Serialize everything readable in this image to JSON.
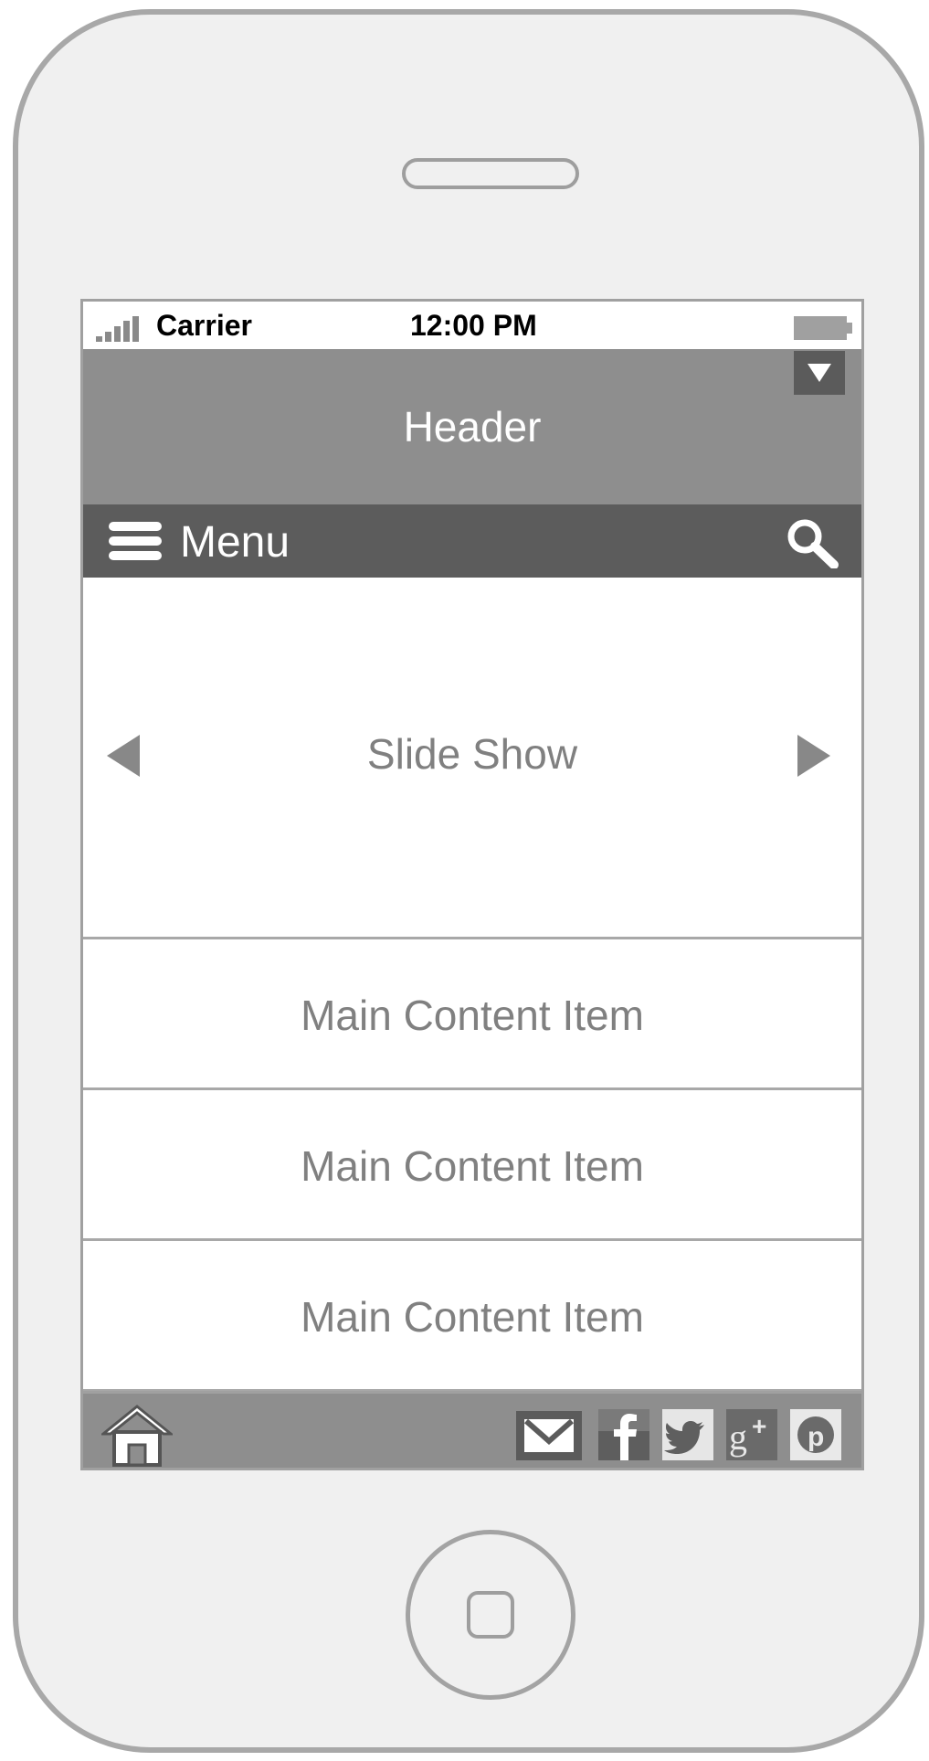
{
  "status_bar": {
    "carrier": "Carrier",
    "time": "12:00 PM"
  },
  "header": {
    "title": "Header"
  },
  "nav": {
    "menu_label": "Menu"
  },
  "slideshow": {
    "label": "Slide Show"
  },
  "main": {
    "items": [
      {
        "label": "Main Content Item"
      },
      {
        "label": "Main Content Item"
      },
      {
        "label": "Main Content Item"
      }
    ]
  },
  "footer": {
    "social_icons": [
      "facebook-icon",
      "twitter-icon",
      "google-plus-icon",
      "pinterest-icon"
    ]
  },
  "colors": {
    "header_bg": "#8e8e8e",
    "menubar_bg": "#5c5c5c",
    "text_gray": "#808080",
    "device_frame": "#a8a8a8"
  }
}
